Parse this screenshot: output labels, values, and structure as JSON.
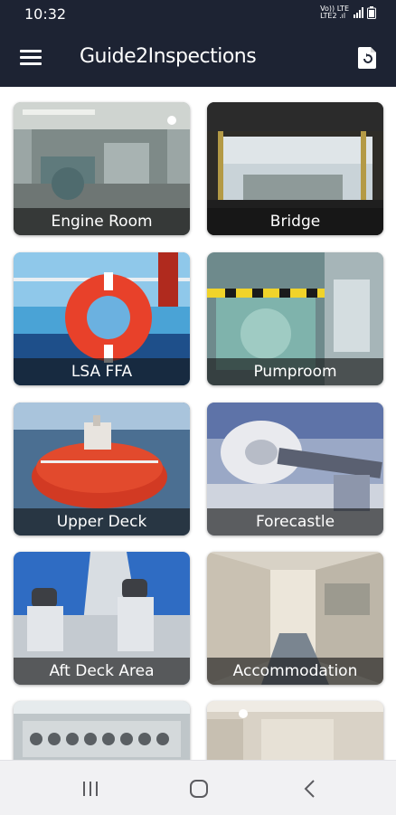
{
  "status": {
    "time": "10:32",
    "carrier_top": "Vo)) LTE",
    "carrier_bottom": "LTE2 .ıl"
  },
  "app": {
    "title": "Guide2Inspections"
  },
  "tiles": [
    {
      "label": "Engine Room"
    },
    {
      "label": "Bridge"
    },
    {
      "label": "LSA FFA"
    },
    {
      "label": "Pumproom"
    },
    {
      "label": "Upper Deck"
    },
    {
      "label": "Forecastle"
    },
    {
      "label": "Aft Deck Area"
    },
    {
      "label": "Accommodation"
    },
    {
      "label": ""
    },
    {
      "label": ""
    }
  ],
  "colors": {
    "app_bar": "#1d2333",
    "nav_bar": "#f1f1f3"
  },
  "icons": {
    "menu": "hamburger-icon",
    "refresh": "document-refresh-icon",
    "nav_recents": "recents-icon",
    "nav_home": "home-icon",
    "nav_back": "back-icon"
  }
}
